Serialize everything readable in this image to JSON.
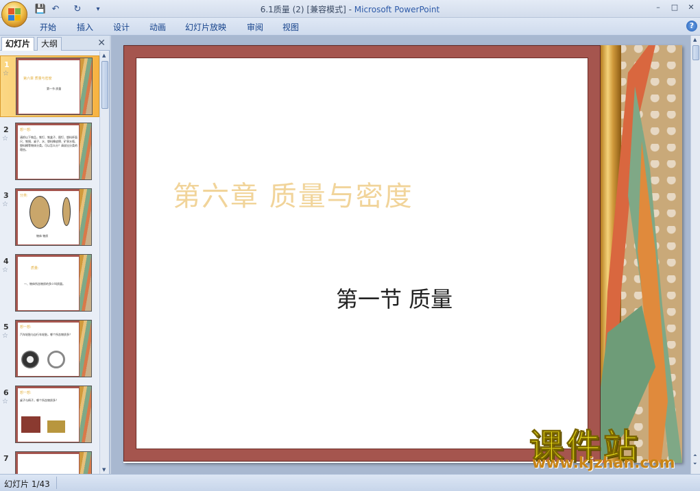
{
  "window": {
    "title_doc": "6.1质量 (2) [兼容模式] - ",
    "title_app": "Microsoft PowerPoint",
    "min_label": "–",
    "max_label": "□",
    "close_label": "✕"
  },
  "quick_access": {
    "save_icon": "💾",
    "undo_icon": "↶",
    "redo_icon": "↻",
    "more_icon": "▾"
  },
  "ribbon": {
    "tabs": [
      "开始",
      "插入",
      "设计",
      "动画",
      "幻灯片放映",
      "审阅",
      "视图"
    ],
    "help_label": "?"
  },
  "panel": {
    "tab_slides": "幻灯片",
    "tab_outline": "大纲",
    "close_label": "✕",
    "thumbnails": [
      {
        "num": "1",
        "title": "第六章 质量与密度",
        "body": "第一节 质量"
      },
      {
        "num": "2",
        "title": "想一想:",
        "body": "请把以下物品，铁钉、铁盒子、图钉、塑料杯面尺、铁锅、桌子、水、塑料橡皮擦、矿泉水瓶、塑料桶等物体分类。可以怎么分？请说出分类的理由。"
      },
      {
        "num": "3",
        "title": "分类:",
        "body": "物体 物质"
      },
      {
        "num": "4",
        "title": "质量:",
        "body": "一、物体所含物质的多少叫质量。"
      },
      {
        "num": "5",
        "title": "想一想:",
        "body": "汽车轮胎与自行车轮胎，哪个所含物质多？"
      },
      {
        "num": "6",
        "title": "想一想:",
        "body": "桌子与椅子，哪个所含物质多？"
      },
      {
        "num": "7",
        "title": "",
        "body": ""
      }
    ]
  },
  "slide": {
    "title": "第六章 质量与密度",
    "subtitle": "第一节 质量"
  },
  "watermark": {
    "cn": "课件站",
    "url": "www.kjzhan.com"
  },
  "status": {
    "slide_counter": "幻灯片 1/43"
  }
}
